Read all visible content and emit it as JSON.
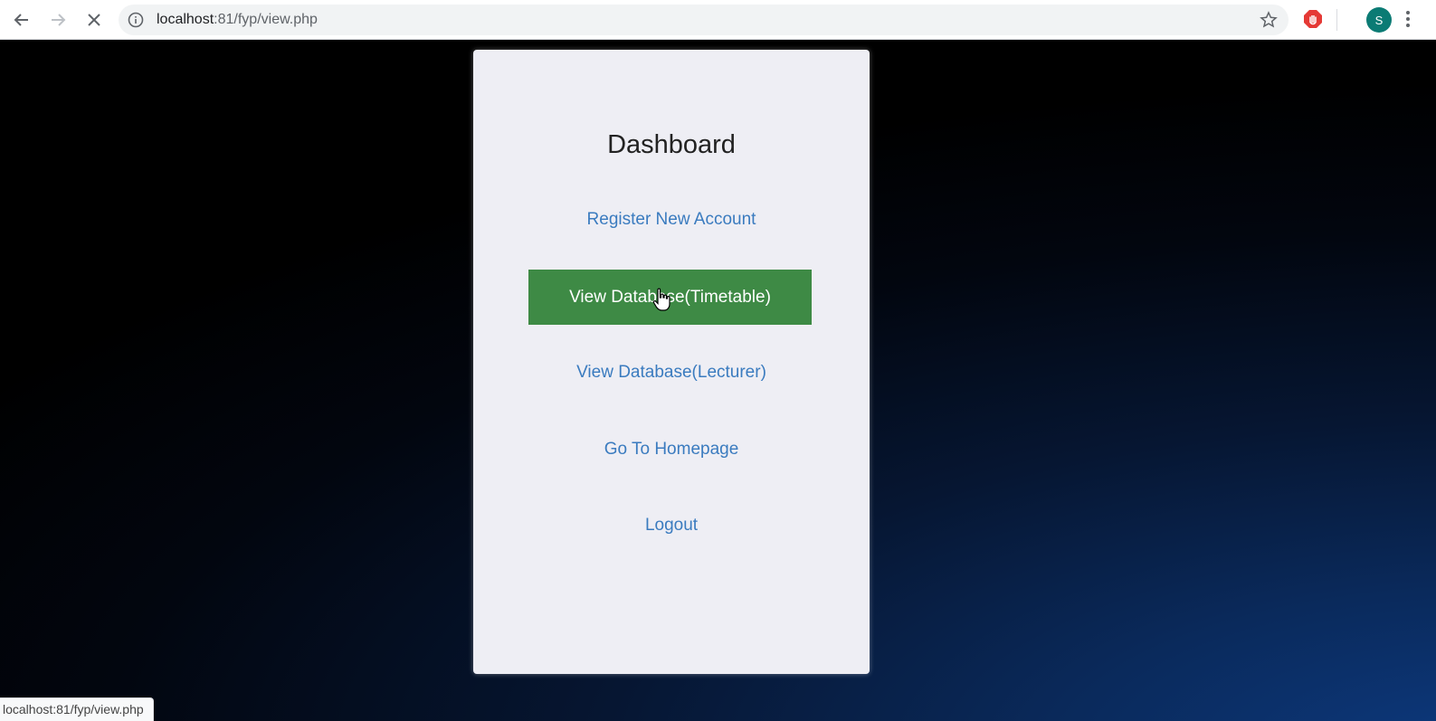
{
  "browser": {
    "url_host": "localhost",
    "url_rest": ":81/fyp/view.php",
    "avatar_letter": "S",
    "status_url": "localhost:81/fyp/view.php",
    "icons": [
      "back-arrow-icon",
      "forward-arrow-icon",
      "stop-loading-icon",
      "site-info-icon",
      "bookmark-star-icon",
      "extension-icon",
      "menu-dots-icon"
    ]
  },
  "page": {
    "title": "Dashboard",
    "links": {
      "register": "Register New Account",
      "view_timetable": "View Database(Timetable)",
      "view_lecturer": "View Database(Lecturer)",
      "homepage": "Go To Homepage",
      "logout": "Logout"
    }
  },
  "colors": {
    "accent_button": "#3e8a45",
    "link": "#3a7bbf",
    "card_bg": "#eeeef4",
    "avatar": "#0b7b74"
  }
}
